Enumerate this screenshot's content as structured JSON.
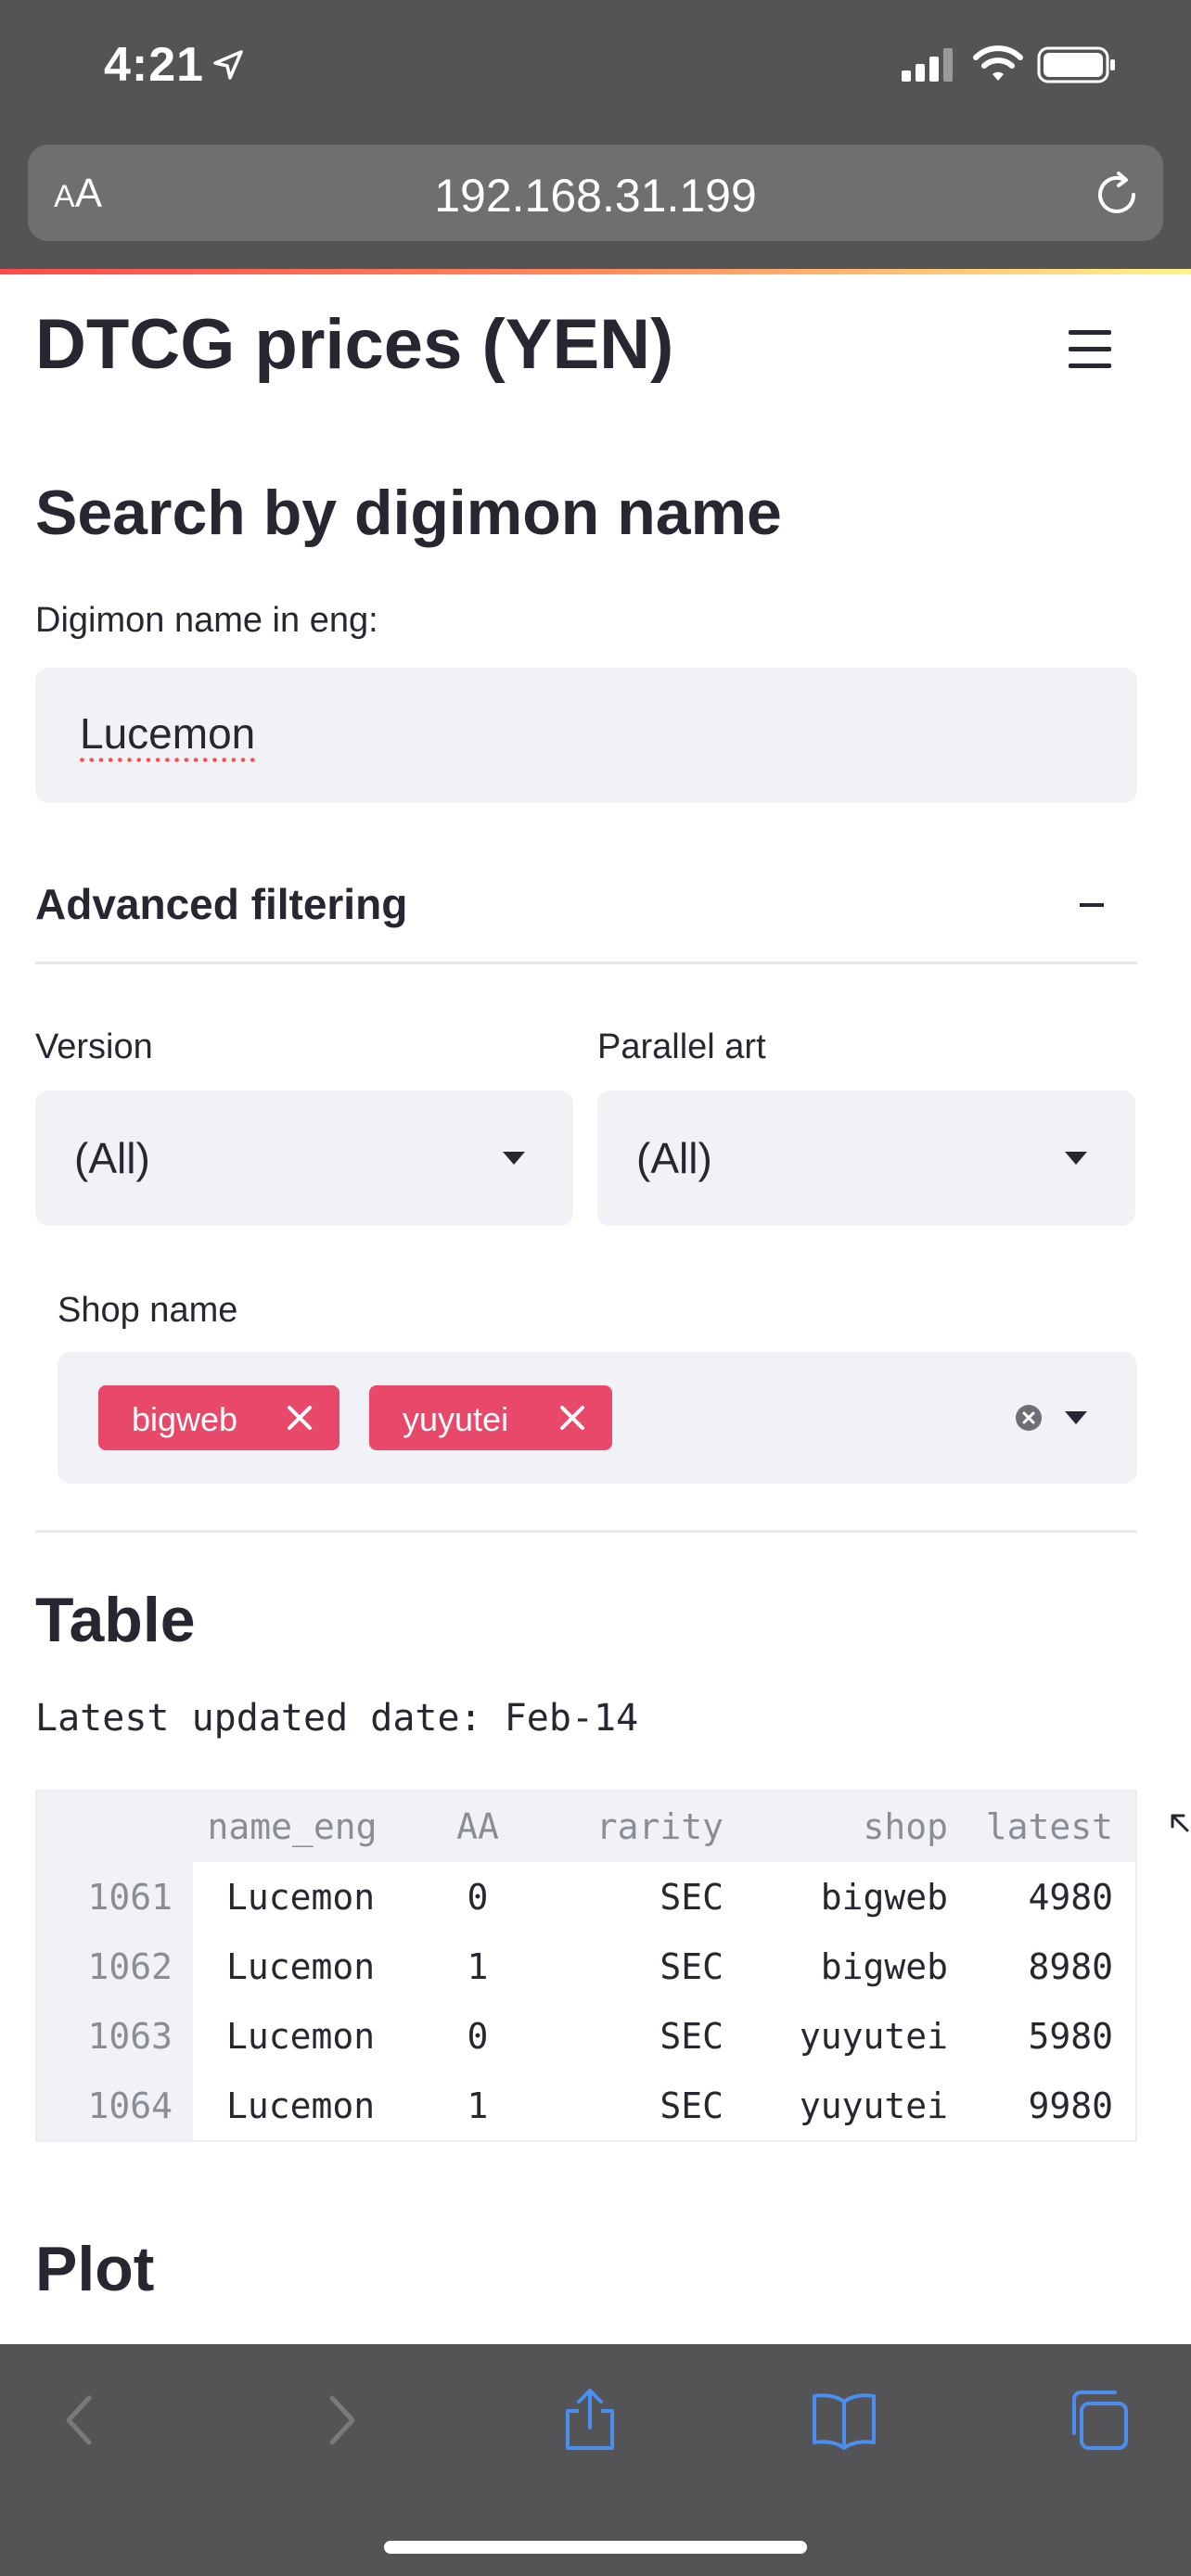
{
  "status_bar": {
    "time": "4:21"
  },
  "browser": {
    "aa_label_small": "A",
    "aa_label_large": "A",
    "url": "192.168.31.199"
  },
  "page": {
    "title": "DTCG prices (YEN)",
    "search_heading": "Search by digimon name",
    "name_label": "Digimon name in eng:",
    "name_value": "Lucemon",
    "advanced_label": "Advanced filtering",
    "version_label": "Version",
    "version_value": "(All)",
    "parallel_label": "Parallel art",
    "parallel_value": "(All)",
    "shop_label": "Shop name",
    "shop_chips": [
      "bigweb",
      "yuyutei"
    ],
    "table_heading": "Table",
    "updated_text": "Latest updated date: Feb-14",
    "plot_heading": "Plot"
  },
  "table": {
    "columns": [
      "name_eng",
      "AA",
      "rarity",
      "shop",
      "latest"
    ],
    "rows": [
      {
        "index": "1061",
        "name_eng": "Lucemon",
        "AA": "0",
        "rarity": "SEC",
        "shop": "bigweb",
        "latest": "4980"
      },
      {
        "index": "1062",
        "name_eng": "Lucemon",
        "AA": "1",
        "rarity": "SEC",
        "shop": "bigweb",
        "latest": "8980"
      },
      {
        "index": "1063",
        "name_eng": "Lucemon",
        "AA": "0",
        "rarity": "SEC",
        "shop": "yuyutei",
        "latest": "5980"
      },
      {
        "index": "1064",
        "name_eng": "Lucemon",
        "AA": "1",
        "rarity": "SEC",
        "shop": "yuyutei",
        "latest": "9980"
      }
    ]
  },
  "colors": {
    "accent": "#e8486a",
    "input_bg": "#f0f2f6",
    "chrome": "#545456",
    "toolbar_icon": "#4a8ff0"
  },
  "icons": [
    "location-arrow-icon",
    "signal-icon",
    "wifi-icon",
    "battery-icon",
    "reload-icon",
    "hamburger-menu-icon",
    "minus-icon",
    "caret-down-icon",
    "close-icon",
    "clear-icon",
    "back-icon",
    "forward-icon",
    "share-icon",
    "bookmarks-icon",
    "tabs-icon"
  ]
}
